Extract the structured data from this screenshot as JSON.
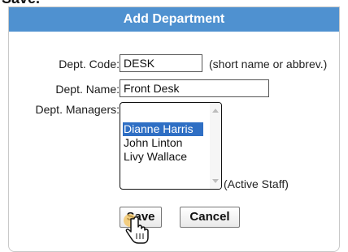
{
  "top_fragment": "Save.",
  "dialog": {
    "title": "Add Department",
    "dept_code": {
      "label": "Dept. Code:",
      "value": "DESK",
      "hint": "(short name or abbrev.)"
    },
    "dept_name": {
      "label": "Dept. Name:",
      "value": "Front Desk"
    },
    "dept_managers": {
      "label": "Dept. Managers:",
      "options": [
        "Dianne Harris",
        "John Linton",
        "Livy Wallace"
      ],
      "selected": "Dianne Harris",
      "hint": "(Active Staff)"
    },
    "buttons": {
      "save": "Save",
      "cancel": "Cancel"
    }
  },
  "colors": {
    "header": "#4f91d0",
    "selection": "#2f6fc4"
  },
  "icons": [
    "hand-pointer-cursor-icon",
    "scroll-up-arrow-icon",
    "scroll-down-arrow-icon"
  ]
}
